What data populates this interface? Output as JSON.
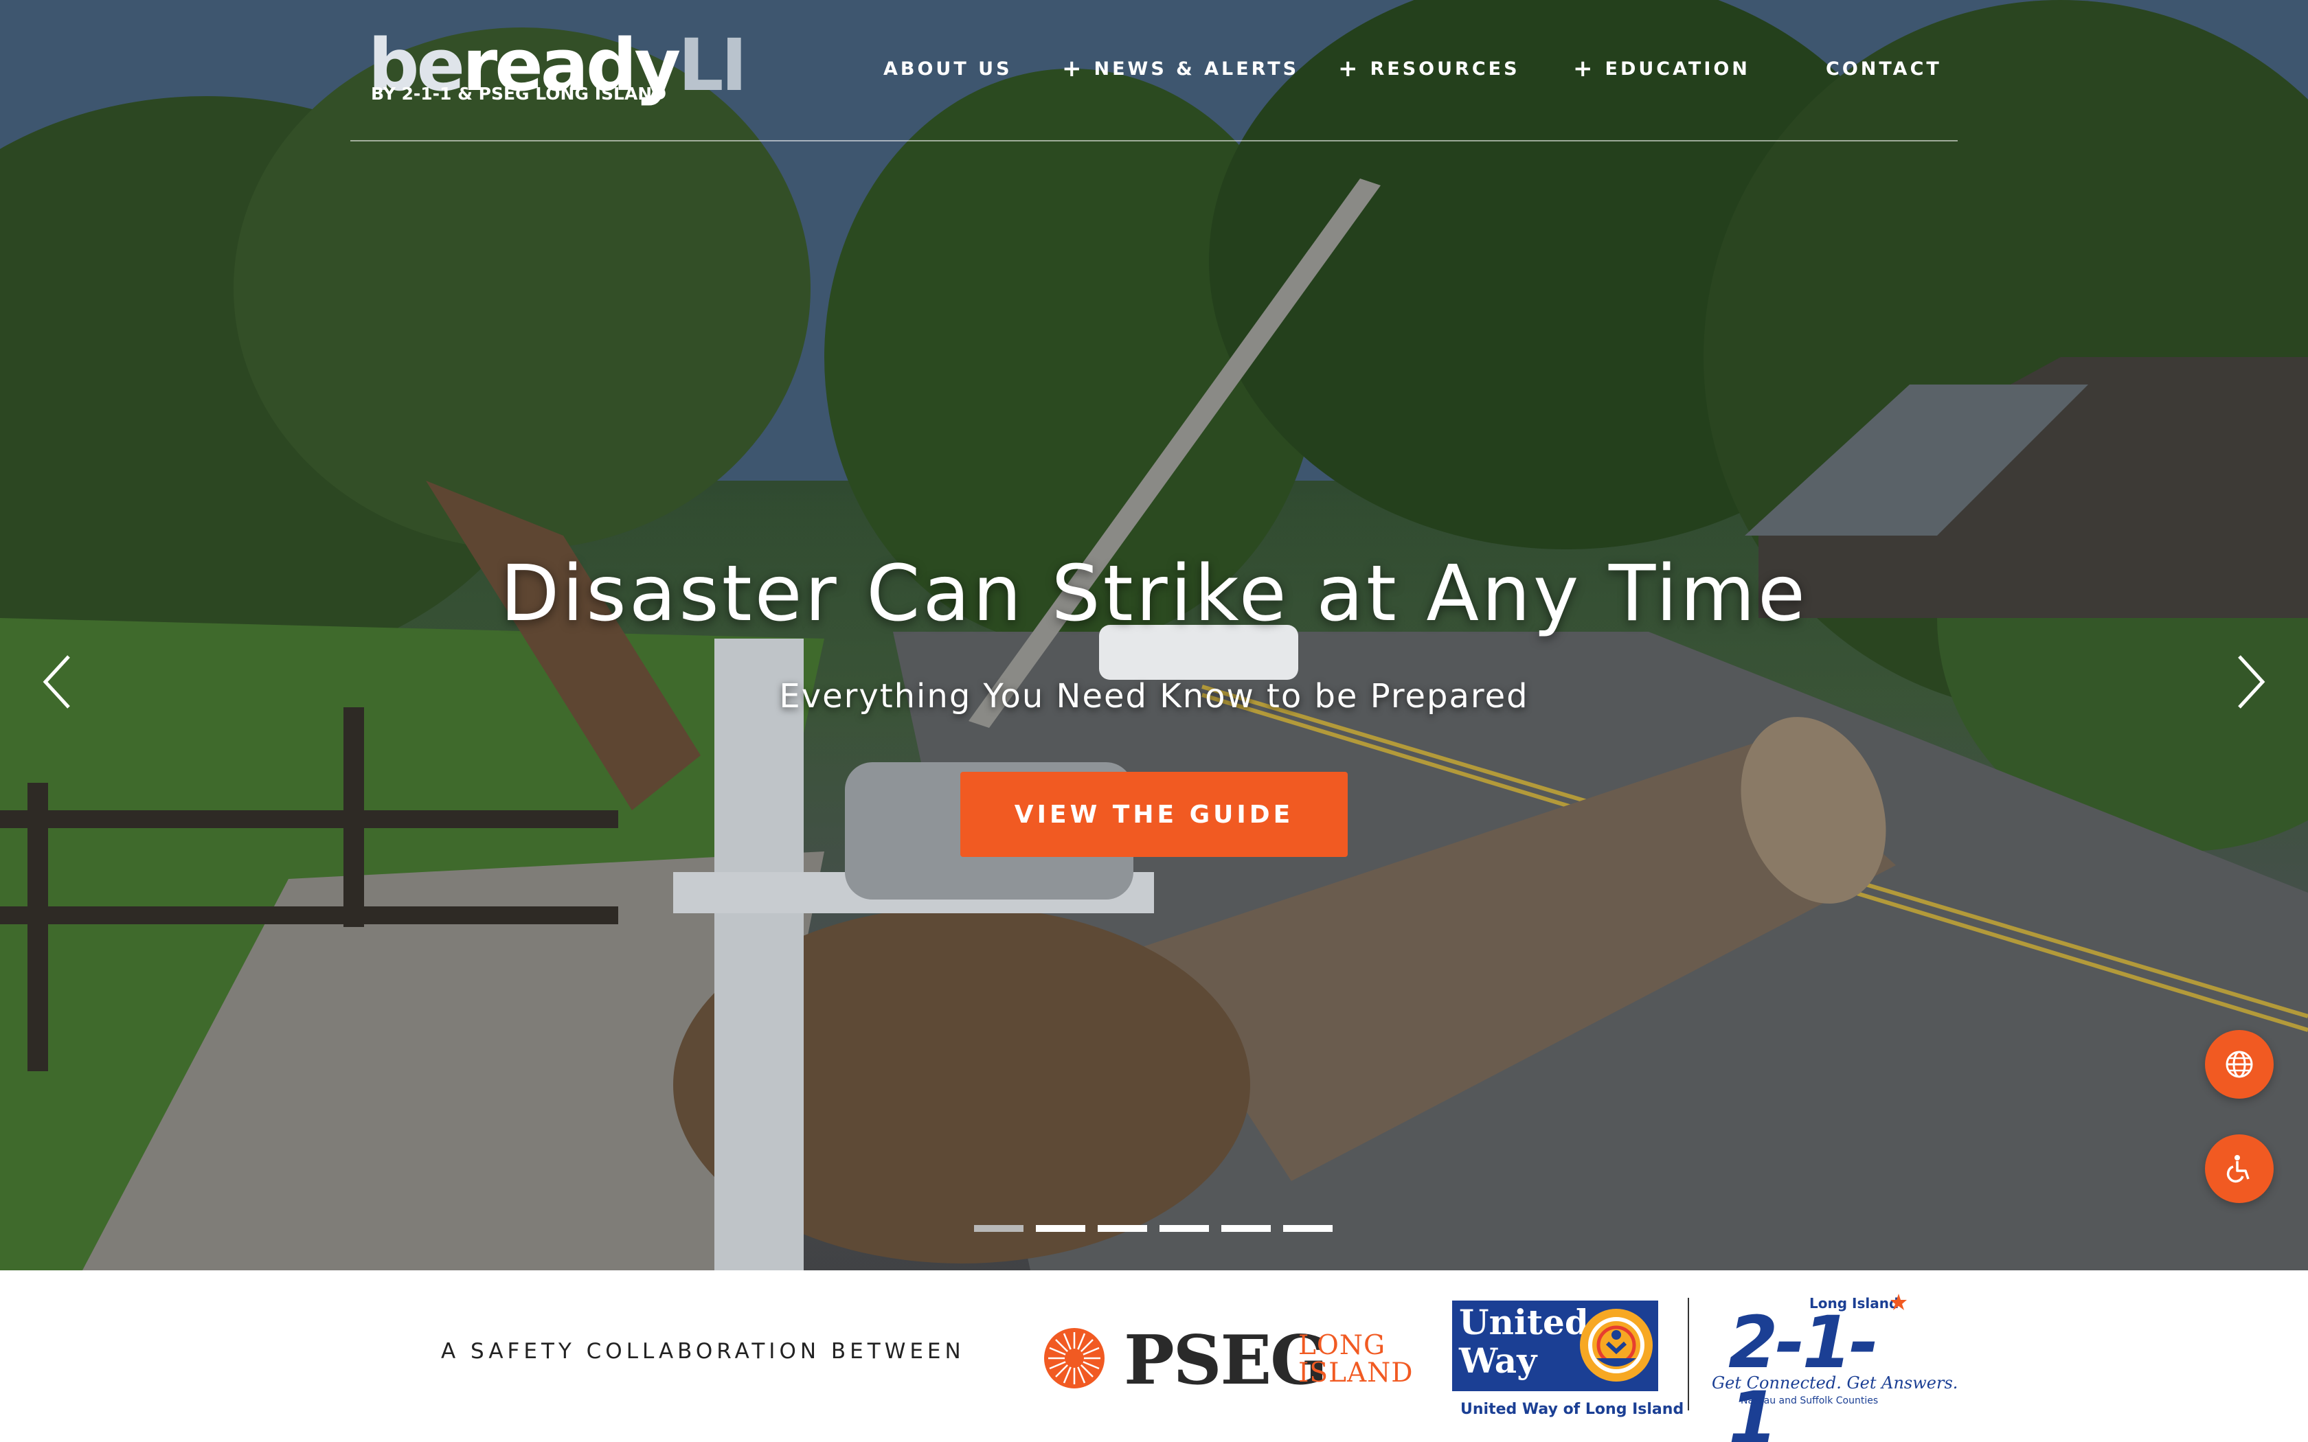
{
  "brand": {
    "logo_be": "be",
    "logo_ready": "ready",
    "logo_li": "LI",
    "logo_sub": "BY 2-1-1 & PSEG LONG ISLAND"
  },
  "nav": {
    "items": [
      {
        "label": "ABOUT US",
        "has_submenu": false
      },
      {
        "label": "NEWS & ALERTS",
        "has_submenu": true
      },
      {
        "label": "RESOURCES",
        "has_submenu": true
      },
      {
        "label": "EDUCATION",
        "has_submenu": true
      },
      {
        "label": "CONTACT",
        "has_submenu": false
      }
    ],
    "submenu_glyph": "+"
  },
  "hero": {
    "headline": "Disaster Can Strike at Any Time",
    "subheadline": "Everything You Need Know to be Prepared",
    "cta_label": "VIEW THE GUIDE",
    "prev_icon": "chevron-left-icon",
    "next_icon": "chevron-right-icon",
    "slides_count": 6,
    "active_slide": 1
  },
  "floating": {
    "globe_icon": "globe-icon",
    "accessibility_icon": "accessibility-icon"
  },
  "partners": {
    "lead_text": "A SAFETY COLLABORATION BETWEEN",
    "pseg_name": "PSEG",
    "pseg_sub_line1": "LONG",
    "pseg_sub_line2": "ISLAND",
    "uw_line1": "United",
    "uw_line2": "Way",
    "uw_caption": "United Way of Long Island",
    "i211_top": "Long Island",
    "i211_number": "2-1-1",
    "i211_tagline": "Get Connected. Get Answers.",
    "i211_small": "Nassau and Suffolk Counties"
  },
  "colors": {
    "accent": "#f15a22",
    "uw_blue": "#1b3f94",
    "uw_gold": "#f7a823",
    "text_dark": "#222222"
  }
}
